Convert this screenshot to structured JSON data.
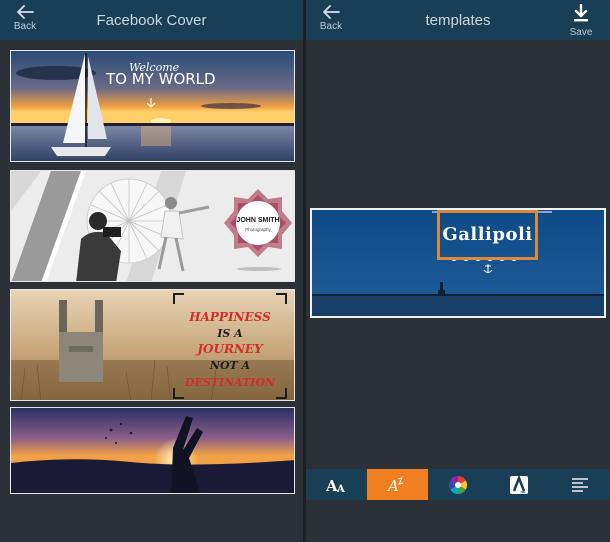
{
  "left": {
    "title": "Facebook Cover",
    "back_label": "Back",
    "covers": [
      {
        "lines": [
          "Welcome",
          "TO MY WORLD"
        ]
      },
      {
        "lines": [
          "JOHN SMITH",
          "Photography"
        ]
      },
      {
        "lines": [
          "HAPPINESS",
          "IS A",
          "JOURNEY",
          "NOT A",
          "DESTINATION"
        ]
      },
      {
        "lines": []
      }
    ]
  },
  "right": {
    "title": "templates",
    "back_label": "Back",
    "save_label": "Save",
    "template_title": "Gallipoli",
    "tools": [
      {
        "name": "font-size-icon",
        "active": false
      },
      {
        "name": "font-style-icon",
        "active": true
      },
      {
        "name": "color-wheel-icon",
        "active": false
      },
      {
        "name": "text-shadow-icon",
        "active": false
      },
      {
        "name": "align-icon",
        "active": false
      }
    ]
  },
  "colors": {
    "topbar": "#193f57",
    "accent": "#f07f22",
    "title_box_border": "#d88a3c",
    "background": "#2c3037"
  }
}
